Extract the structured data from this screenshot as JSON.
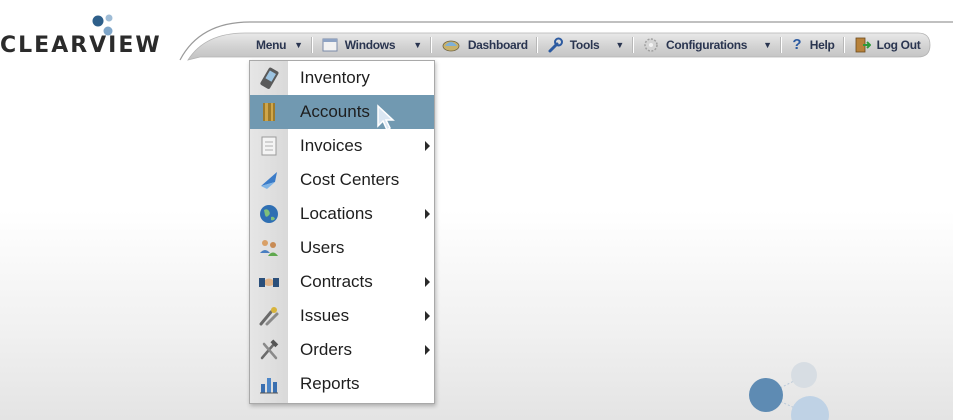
{
  "app": {
    "logo_text": "CLEARVIEW",
    "brand_colors": {
      "logo_dot_dark": "#2e5f8a",
      "logo_dot_light": "#7fa6c9",
      "highlight": "#7199b1"
    }
  },
  "toolbar": {
    "items": [
      {
        "label": "Menu",
        "has_dropdown": true,
        "icon": null
      },
      {
        "label": "Windows",
        "has_dropdown": true,
        "icon": "windows-icon"
      },
      {
        "label": "Dashboard",
        "has_dropdown": false,
        "icon": "dashboard-icon"
      },
      {
        "label": "Tools",
        "has_dropdown": true,
        "icon": "wrench-icon"
      },
      {
        "label": "Configurations",
        "has_dropdown": true,
        "icon": "gear-icon"
      },
      {
        "label": "Help",
        "has_dropdown": false,
        "icon": "question-icon"
      },
      {
        "label": "Log Out",
        "has_dropdown": false,
        "icon": "logout-door-icon"
      }
    ]
  },
  "menu": {
    "items": [
      {
        "label": "Inventory",
        "icon": "mobile-phone-icon",
        "submenu": false,
        "highlighted": false
      },
      {
        "label": "Accounts",
        "icon": "ledger-book-icon",
        "submenu": false,
        "highlighted": true
      },
      {
        "label": "Invoices",
        "icon": "invoice-document-icon",
        "submenu": true,
        "highlighted": false
      },
      {
        "label": "Cost Centers",
        "icon": "funnel-icon",
        "submenu": false,
        "highlighted": false
      },
      {
        "label": "Locations",
        "icon": "globe-icon",
        "submenu": true,
        "highlighted": false
      },
      {
        "label": "Users",
        "icon": "users-group-icon",
        "submenu": false,
        "highlighted": false
      },
      {
        "label": "Contracts",
        "icon": "handshake-icon",
        "submenu": true,
        "highlighted": false
      },
      {
        "label": "Issues",
        "icon": "tools-issues-icon",
        "submenu": true,
        "highlighted": false
      },
      {
        "label": "Orders",
        "icon": "hammer-wrench-icon",
        "submenu": true,
        "highlighted": false
      },
      {
        "label": "Reports",
        "icon": "bar-chart-icon",
        "submenu": false,
        "highlighted": false
      }
    ]
  }
}
